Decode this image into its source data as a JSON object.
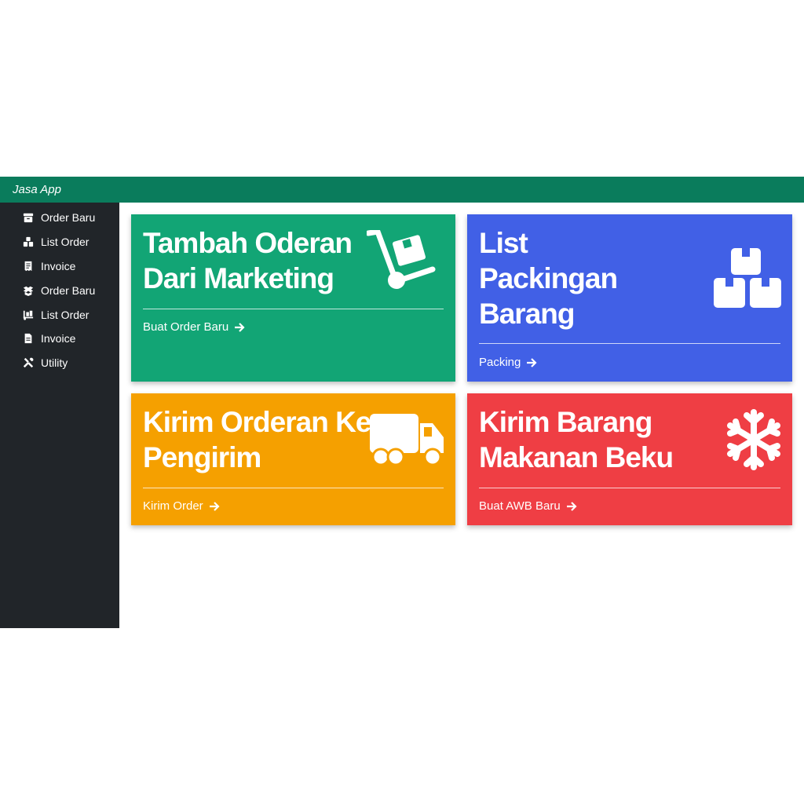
{
  "app": {
    "brand": "Jasa App"
  },
  "sidebar": {
    "items": [
      {
        "label": "Order Baru",
        "icon": "box-icon"
      },
      {
        "label": "List Order",
        "icon": "boxes-icon"
      },
      {
        "label": "Invoice",
        "icon": "receipt-icon"
      },
      {
        "label": "Order Baru",
        "icon": "box-open-icon"
      },
      {
        "label": "List Order",
        "icon": "dolly-icon"
      },
      {
        "label": "Invoice",
        "icon": "file-invoice-icon"
      },
      {
        "label": "Utility",
        "icon": "tools-icon"
      }
    ]
  },
  "cards": [
    {
      "title_line1": "Tambah Oderan",
      "title_line2": "Dari Marketing",
      "link": "Buat Order Baru",
      "color": "#12a575",
      "icon": "dolly-icon"
    },
    {
      "title_line1": "List",
      "title_line2": "Packingan",
      "title_line3": "Barang",
      "link": "Packing",
      "color": "#4160e6",
      "icon": "boxes-icon"
    },
    {
      "title_line1": "Kirim Orderan Ke",
      "title_line2": "Pengirim",
      "link": "Kirim Order",
      "color": "#f5a000",
      "icon": "truck-icon"
    },
    {
      "title_line1": "Kirim Barang",
      "title_line2": "Makanan Beku",
      "link": "Buat AWB Baru",
      "color": "#ef3e44",
      "icon": "snowflake-icon"
    }
  ]
}
